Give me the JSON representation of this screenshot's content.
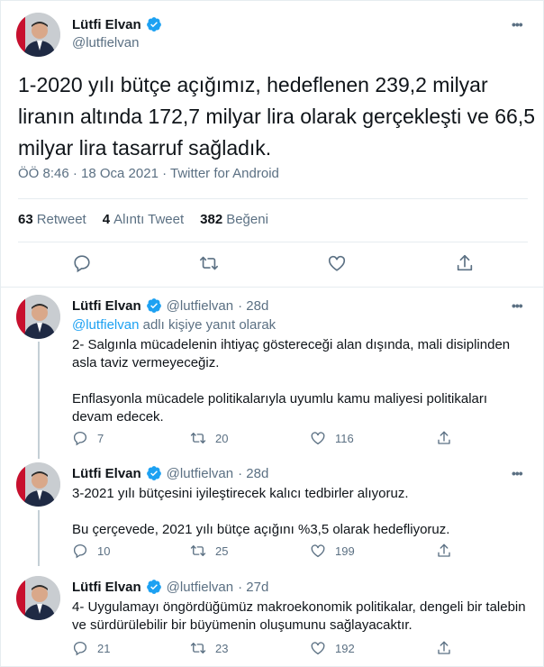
{
  "main": {
    "name": "Lütfi Elvan",
    "handle": "@lutfielvan",
    "text": "1-2020 yılı bütçe açığımız, hedeflenen 239,2 milyar liranın altında 172,7 milyar lira olarak gerçekleşti ve 66,5 milyar lira tasarruf sağladık.",
    "meta": "ÖÖ 8:46 · 18 Oca 2021 · Twitter for Android",
    "retweets_count": "63",
    "retweets_label": "Retweet",
    "quotes_count": "4",
    "quotes_label": "Alıntı Tweet",
    "likes_count": "382",
    "likes_label": "Beğeni"
  },
  "replies": [
    {
      "name": "Lütfi Elvan",
      "handle": "@lutfielvan",
      "time": "· 28d",
      "reply_to_handle": "@lutfielvan",
      "reply_to_suffix": " adlı kişiye yanıt olarak",
      "paragraphs": [
        "2- Salgınla mücadelenin ihtiyaç göstereceği alan dışında, mali disiplinden asla taviz vermeyeceğiz.",
        "Enflasyonla mücadele politikalarıyla uyumlu kamu maliyesi politikaları devam edecek."
      ],
      "replies": "7",
      "retweets": "20",
      "likes": "116"
    },
    {
      "name": "Lütfi Elvan",
      "handle": "@lutfielvan",
      "time": "· 28d",
      "paragraphs": [
        "3-2021 yılı bütçesini iyileştirecek kalıcı tedbirler alıyoruz.",
        "Bu çerçevede, 2021 yılı bütçe açığını %3,5 olarak hedefliyoruz."
      ],
      "replies": "10",
      "retweets": "25",
      "likes": "199"
    },
    {
      "name": "Lütfi Elvan",
      "handle": "@lutfielvan",
      "time": "· 27d",
      "paragraphs": [
        "4- Uygulamayı öngördüğümüz makroekonomik politikalar, dengeli bir talebin ve sürdürülebilir bir büyümenin oluşumunu sağlayacaktır."
      ],
      "replies": "21",
      "retweets": "23",
      "likes": "192"
    }
  ],
  "icons": {
    "more": "more-icon",
    "verified": "verified-badge-icon",
    "reply": "reply-icon",
    "retweet": "retweet-icon",
    "like": "heart-icon",
    "share": "share-icon"
  },
  "colors": {
    "accent": "#1da1f2",
    "secondary_text": "#5b7083",
    "divider": "#e6ecf0"
  }
}
